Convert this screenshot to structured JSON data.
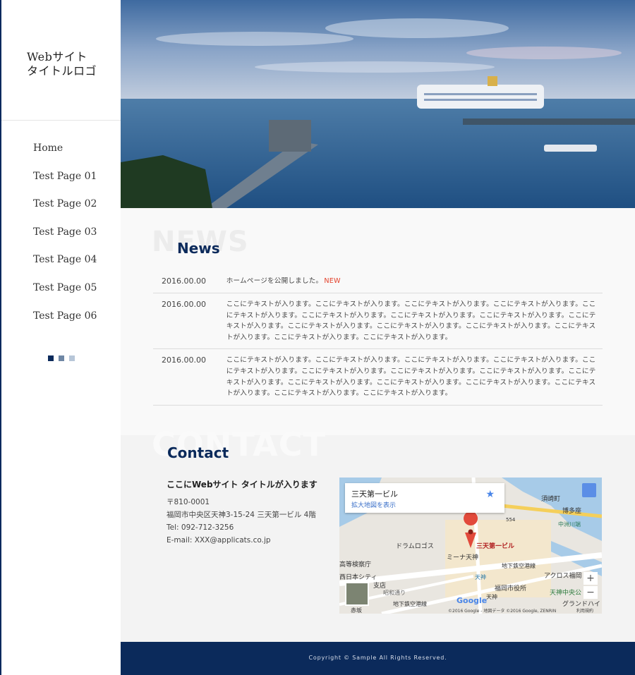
{
  "site": {
    "logo_line1": "Webサイト",
    "logo_line2": "タイトルロゴ"
  },
  "nav": {
    "items": [
      "Home",
      "Test Page 01",
      "Test Page 02",
      "Test Page 03",
      "Test Page 04",
      "Test Page 05",
      "Test Page 06"
    ]
  },
  "slider": {
    "dot_colors": [
      "#0b2a5b",
      "#6f87a5",
      "#b7c6d8"
    ]
  },
  "news": {
    "bg_text": "NEWS",
    "title": "News",
    "items": [
      {
        "date": "2016.00.00",
        "text": "ホームページを公開しました。",
        "badge": "NEW"
      },
      {
        "date": "2016.00.00",
        "text": "ここにテキストが入ります。ここにテキストが入ります。ここにテキストが入ります。ここにテキストが入ります。ここにテキストが入ります。ここにテキストが入ります。ここにテキストが入ります。ここにテキストが入ります。ここにテキストが入ります。ここにテキストが入ります。ここにテキストが入ります。ここにテキストが入ります。ここにテキストが入ります。ここにテキストが入ります。ここにテキストが入ります。",
        "badge": ""
      },
      {
        "date": "2016.00.00",
        "text": "ここにテキストが入ります。ここにテキストが入ります。ここにテキストが入ります。ここにテキストが入ります。ここにテキストが入ります。ここにテキストが入ります。ここにテキストが入ります。ここにテキストが入ります。ここにテキストが入ります。ここにテキストが入ります。ここにテキストが入ります。ここにテキストが入ります。ここにテキストが入ります。ここにテキストが入ります。ここにテキストが入ります。",
        "badge": ""
      }
    ]
  },
  "contact": {
    "bg_text": "CONTACT",
    "title": "Contact",
    "company": "ここにWebサイト タイトルが入ります",
    "postal": "〒810-0001",
    "address": "福岡市中央区天神3-15-24 三天第一ビル 4階",
    "tel": "Tel: 092-712-3256",
    "email": "E-mail: XXX@applicats.co.jp"
  },
  "map": {
    "place_name": "三天第一ビル",
    "enlarge_link": "拡大地図を表示",
    "pin_label": "三天第一ビル",
    "labels": [
      "須崎町",
      "博多座",
      "中洲川端",
      "ドラムロゴス",
      "ミーナ天神",
      "高等検察庁",
      "西日本シティ",
      "支店",
      "昭和通り",
      "赤坂",
      "地下鉄空港線",
      "地下鉄空港線",
      "天神",
      "天神",
      "福岡市役所",
      "アクロス福岡",
      "天神中央公",
      "グランドハイ",
      "554"
    ],
    "attribution": "©2016 Google - 地図データ ©2016 Google, ZENRIN",
    "terms": "利用規約",
    "google": "Google"
  },
  "footer": {
    "copyright": "Copyright © Sample All Rights Reserved."
  }
}
